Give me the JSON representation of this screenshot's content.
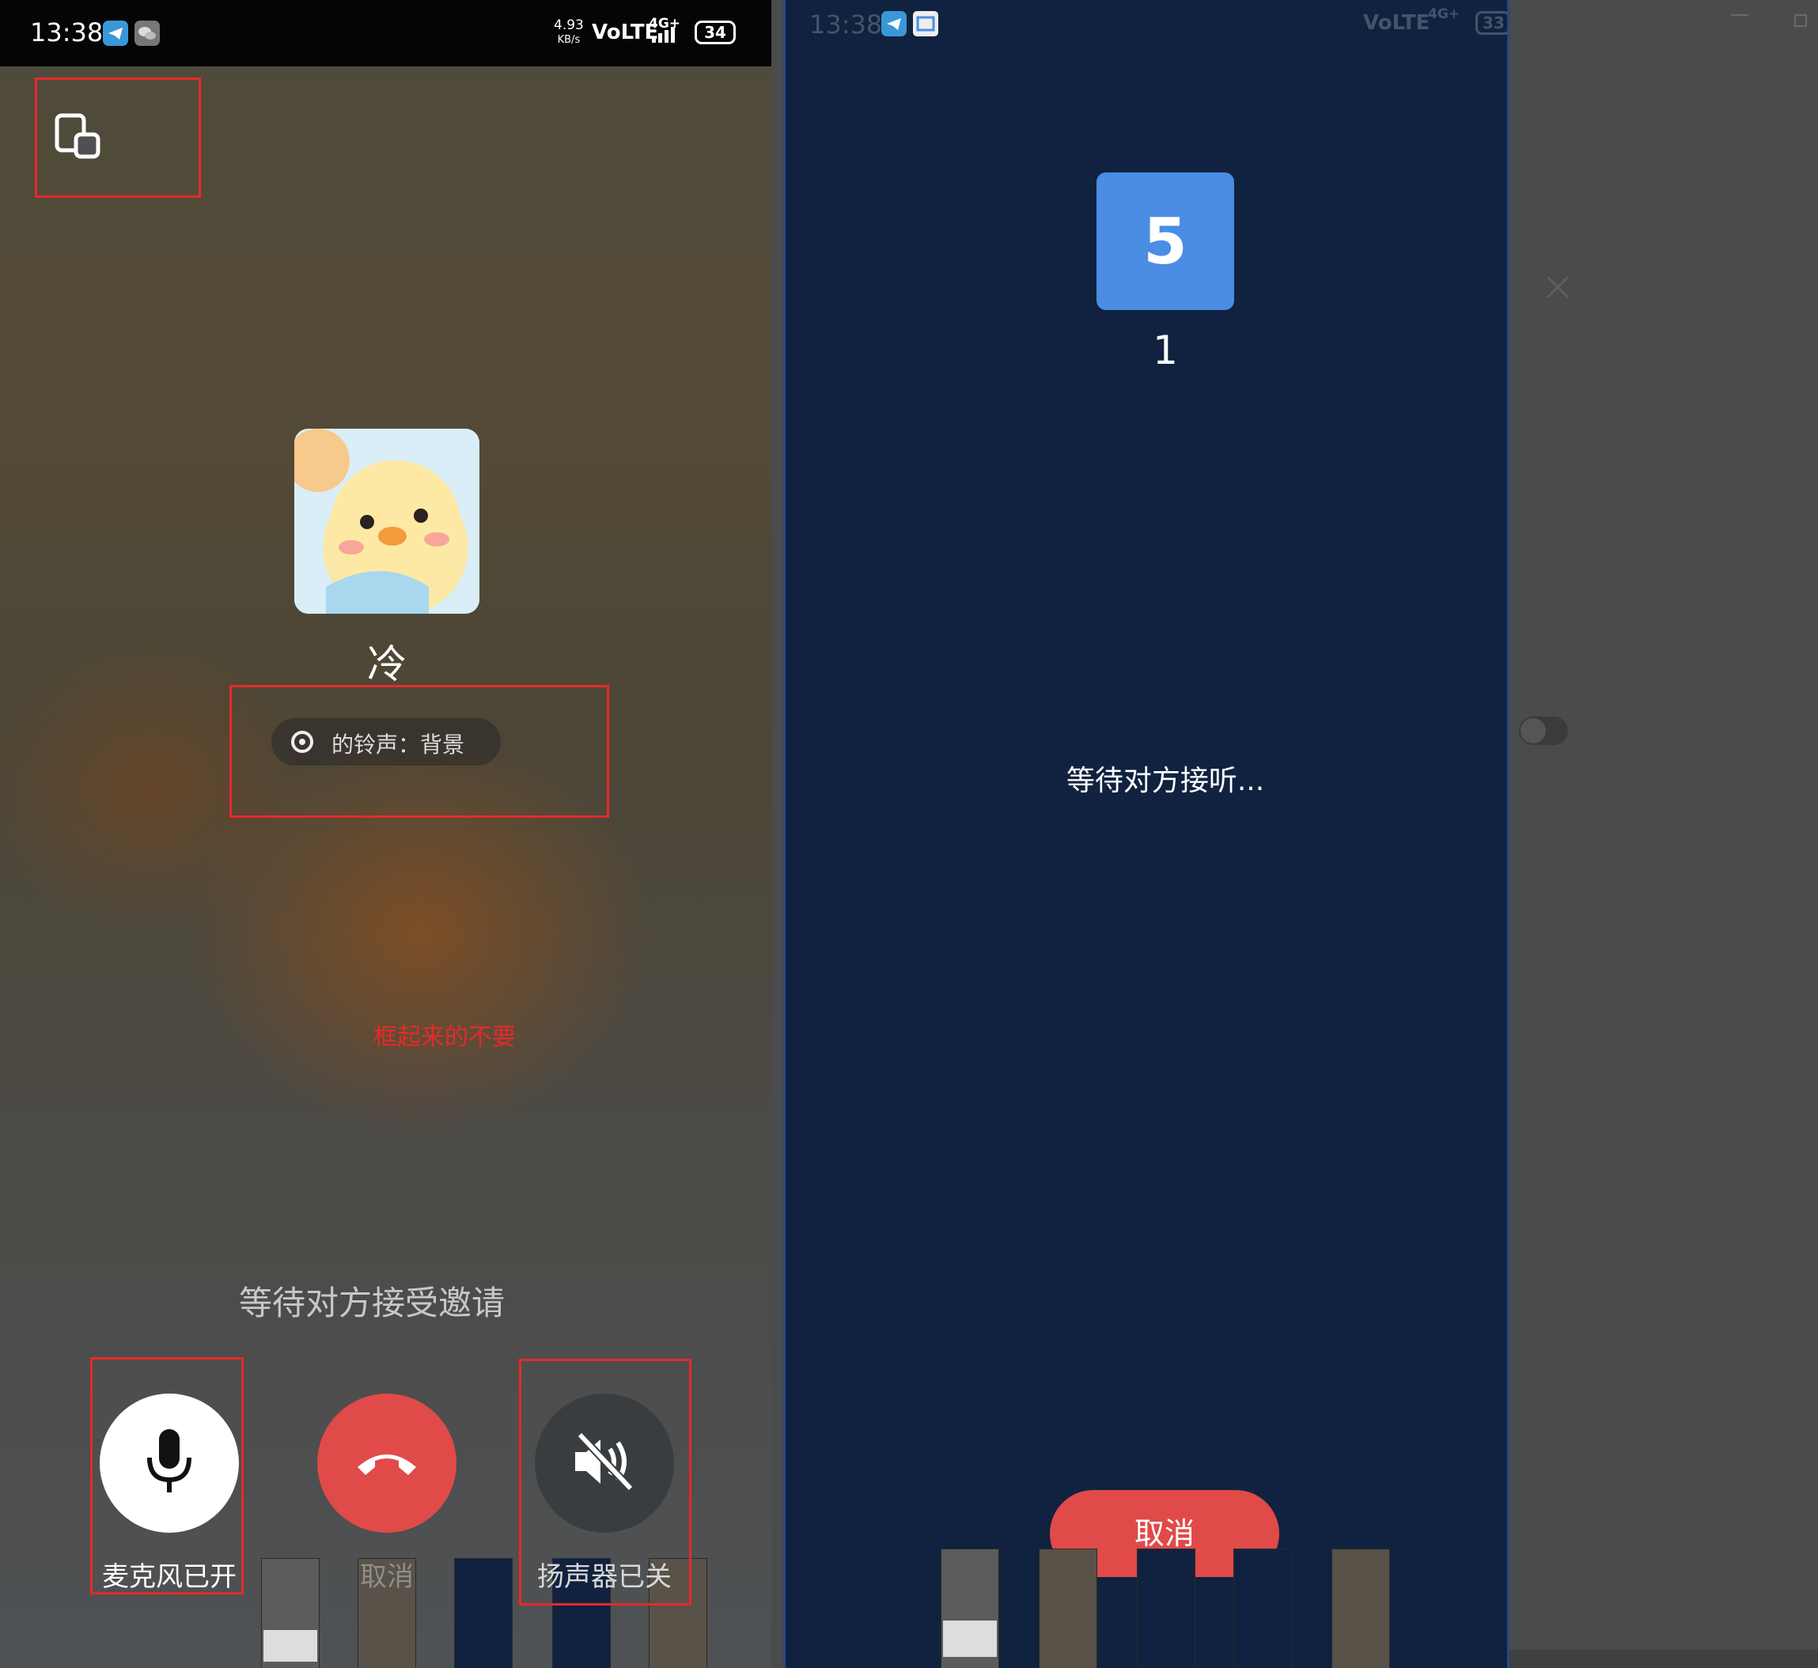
{
  "left_phone": {
    "status": {
      "time": "13:38",
      "net_speed_value": "4.93",
      "net_speed_unit": "KB/s",
      "volte": "VoLTE",
      "network": "4G+",
      "battery": "34"
    },
    "contact_name": "冷",
    "ringtone_text": "的铃声：背景",
    "wait_text": "等待对方接受邀请",
    "annotation_note": "框起来的不要",
    "buttons": {
      "mic_label": "麦克风已开",
      "hangup_label": "取消",
      "speaker_label": "扬声器已关"
    },
    "icons": {
      "minimize": "window-minimize-icon",
      "mic": "microphone-icon",
      "hangup": "phone-hangup-icon",
      "speaker": "speaker-muted-icon",
      "ringtone": "music-disc-icon",
      "avatar": "duck-avatar"
    }
  },
  "right_phone": {
    "status": {
      "time": "13:38",
      "volte": "VoLTE",
      "network": "4G+",
      "battery": "33"
    },
    "avatar_text": "5",
    "username": "1",
    "waiting_text": "等待对方接听...",
    "cancel_label": "取消"
  },
  "colors": {
    "hangup_red": "#e04a48",
    "avatar_blue": "#4a8de3",
    "annotation_red": "#e52a2a",
    "right_bg": "#10223f"
  }
}
